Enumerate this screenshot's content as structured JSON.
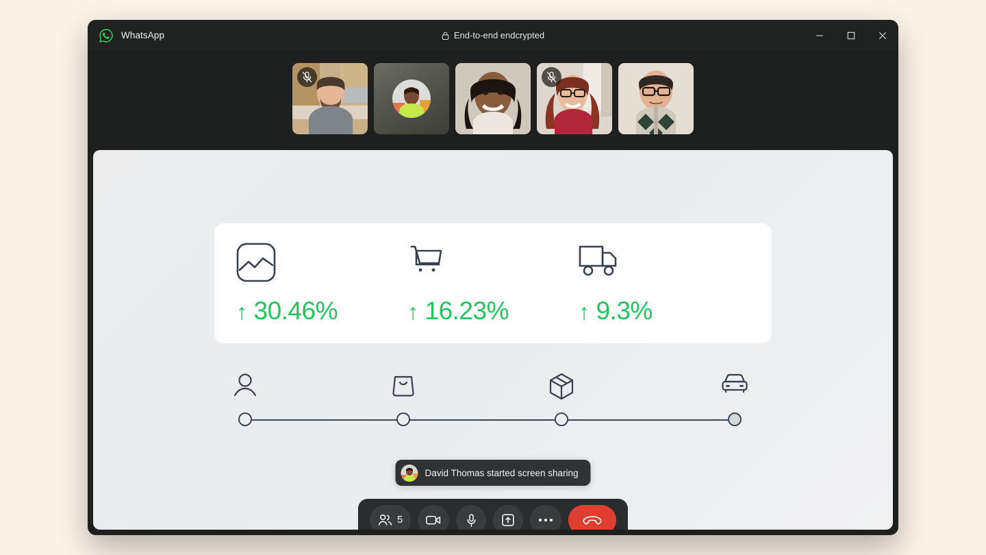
{
  "window": {
    "app_name": "WhatsApp",
    "logo_icon": "whatsapp-logo",
    "encryption_label": "End-to-end endcrypted",
    "lock_icon": "lock-icon",
    "controls": {
      "minimize": "minimize-icon",
      "maximize": "maximize-icon",
      "close": "close-icon"
    }
  },
  "participants": [
    {
      "id": "p1",
      "type": "video",
      "muted": true,
      "mute_icon": "mic-off-icon"
    },
    {
      "id": "p2",
      "type": "avatar",
      "muted": false
    },
    {
      "id": "p3",
      "type": "video",
      "muted": false
    },
    {
      "id": "p4",
      "type": "video",
      "muted": true,
      "mute_icon": "mic-off-icon"
    },
    {
      "id": "p5",
      "type": "video",
      "muted": false
    }
  ],
  "shared_screen": {
    "metrics": [
      {
        "icon": "chart-image-icon",
        "arrow": "↑",
        "value": "30.46%",
        "trend": "up"
      },
      {
        "icon": "shopping-cart-icon",
        "arrow": "↑",
        "value": "16.23%",
        "trend": "up"
      },
      {
        "icon": "delivery-truck-icon",
        "arrow": "↑",
        "value": "9.3%",
        "trend": "up"
      }
    ],
    "funnel": {
      "steps": [
        {
          "icon": "user-icon",
          "position": 0,
          "state": "open"
        },
        {
          "icon": "shopping-bag-icon",
          "position": 33.3,
          "state": "open"
        },
        {
          "icon": "package-box-icon",
          "position": 66.6,
          "state": "open"
        },
        {
          "icon": "car-icon",
          "position": 100,
          "state": "filled"
        }
      ]
    },
    "accent_green": "#22c65c",
    "icon_color": "#364150"
  },
  "toast": {
    "avatar_icon": "participant-avatar",
    "message": "David Thomas started screen sharing"
  },
  "call_controls": [
    {
      "name": "participants",
      "icon": "people-icon",
      "count": "5"
    },
    {
      "name": "camera",
      "icon": "video-camera-icon"
    },
    {
      "name": "microphone",
      "icon": "microphone-icon"
    },
    {
      "name": "share-screen",
      "icon": "share-screen-icon"
    },
    {
      "name": "more",
      "icon": "ellipsis-icon"
    },
    {
      "name": "end-call",
      "icon": "hang-up-icon",
      "color": "#e03e31"
    }
  ]
}
